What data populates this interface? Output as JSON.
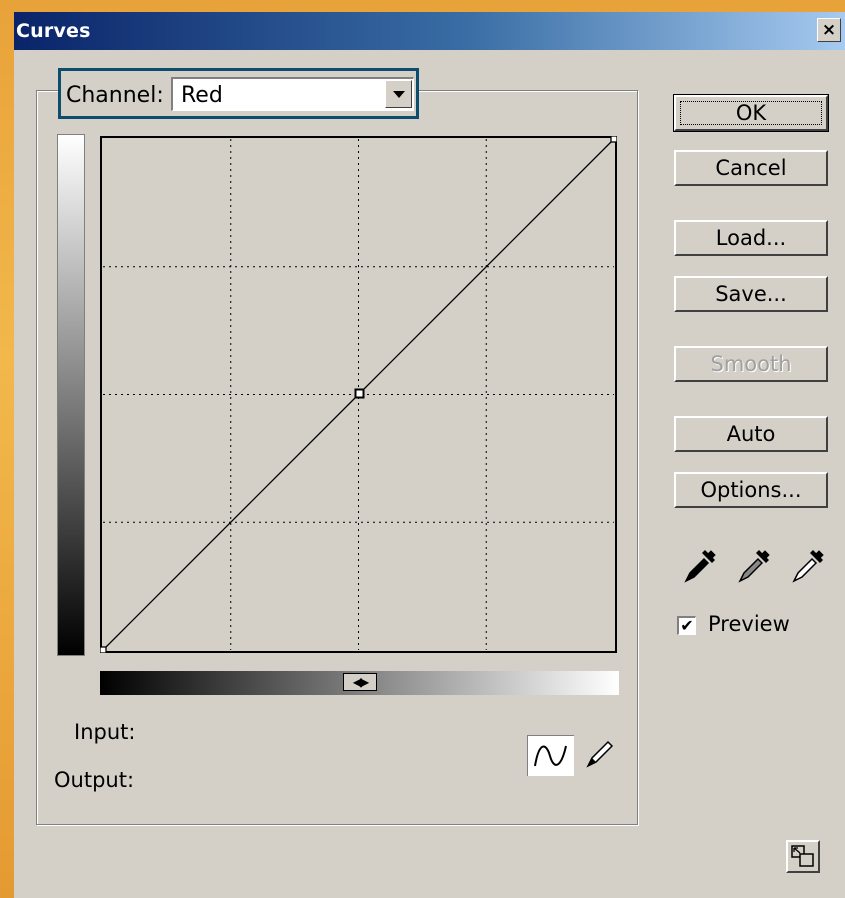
{
  "window": {
    "title": "Curves",
    "close_label": "×"
  },
  "channel": {
    "label": "Channel:",
    "selected": "Red"
  },
  "curve": {
    "grid_divisions": 4,
    "points": [
      [
        0,
        0
      ],
      [
        128,
        128
      ],
      [
        255,
        255
      ]
    ]
  },
  "readout": {
    "input_label": "Input:",
    "output_label": "Output:"
  },
  "buttons": {
    "ok": "OK",
    "cancel": "Cancel",
    "load": "Load...",
    "save": "Save...",
    "smooth": "Smooth",
    "auto": "Auto",
    "options": "Options..."
  },
  "preview": {
    "label": "Preview",
    "checked": true,
    "check_glyph": "✔"
  },
  "icons": {
    "curve_tool": "curve-tool-icon",
    "pencil_tool": "pencil-icon",
    "black_eyedropper": "black-eyedropper-icon",
    "gray_eyedropper": "gray-eyedropper-icon",
    "white_eyedropper": "white-eyedropper-icon",
    "expand": "expand-view-icon"
  }
}
